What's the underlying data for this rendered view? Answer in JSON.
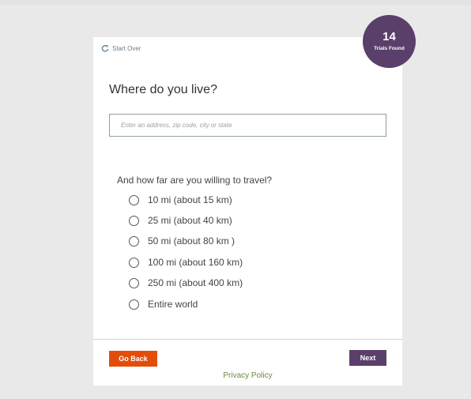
{
  "header": {
    "start_over_label": "Start Over",
    "trials_count": "14",
    "trials_label": "Trials Found"
  },
  "question": {
    "title": "Where do you live?",
    "address_placeholder": "Enter an address, zip code, city or state",
    "address_value": ""
  },
  "travel": {
    "question": "And how far are you willing to travel?",
    "selected": null,
    "options": [
      {
        "label": "10 mi (about 15 km)"
      },
      {
        "label": "25 mi (about 40 km)"
      },
      {
        "label": "50 mi (about 80 km )"
      },
      {
        "label": "100 mi (about 160 km)"
      },
      {
        "label": "250 mi (about 400 km)"
      },
      {
        "label": "Entire world"
      }
    ]
  },
  "footer": {
    "back_label": "Go Back",
    "next_label": "Next",
    "privacy_label": "Privacy Policy"
  },
  "colors": {
    "accent_purple": "#5a3f6b",
    "back_orange": "#e24d0a",
    "link_green": "#6e8a3e"
  }
}
